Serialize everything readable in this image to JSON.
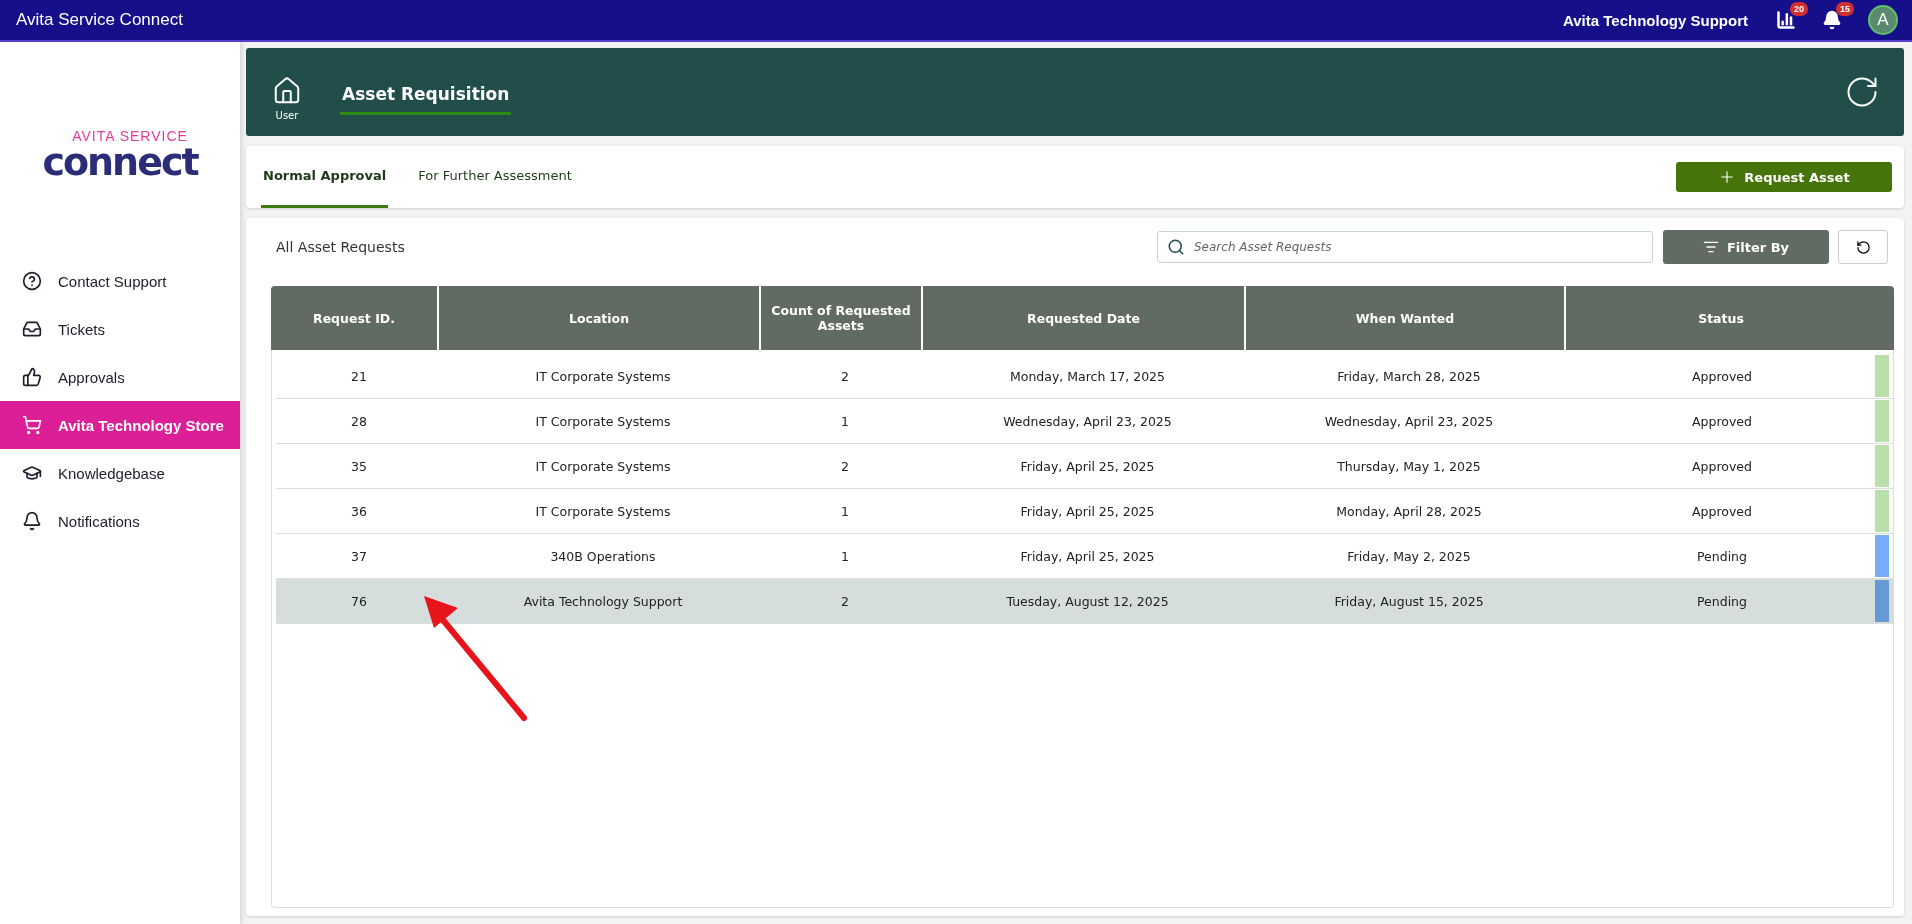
{
  "app_bar": {
    "title": "Avita Service Connect",
    "user_name": "Avita Technology Support",
    "report_badge": "20",
    "notification_badge": "15",
    "avatar_letter": "A"
  },
  "logo": {
    "top": "AVITA SERVICE",
    "bottom": "connect"
  },
  "sidebar": {
    "items": [
      {
        "label": "Contact Support",
        "selected": false
      },
      {
        "label": "Tickets",
        "selected": false
      },
      {
        "label": "Approvals",
        "selected": false
      },
      {
        "label": "Avita Technology Store",
        "selected": true
      },
      {
        "label": "Knowledgebase",
        "selected": false
      },
      {
        "label": "Notifications",
        "selected": false
      }
    ]
  },
  "header": {
    "home_label": "User",
    "title": "Asset Requisition"
  },
  "tabs": [
    {
      "label": "Normal Approval",
      "selected": true
    },
    {
      "label": "For Further Assessment",
      "selected": false
    }
  ],
  "request_button": "Request Asset",
  "list": {
    "title": "All Asset Requests",
    "search": {
      "placeholder": "Search Asset Requests"
    },
    "filter_button": "Filter By"
  },
  "table": {
    "columns": [
      "Request ID.",
      "Location",
      "Count of Requested Assets",
      "Requested Date",
      "When Wanted",
      "Status"
    ],
    "rows": [
      {
        "cells": [
          "21",
          "IT Corporate Systems",
          "2",
          "Monday, March 17, 2025",
          "Friday, March 28, 2025",
          "Approved"
        ],
        "color": "#b9dfaa",
        "selected": false
      },
      {
        "cells": [
          "28",
          "IT Corporate Systems",
          "1",
          "Wednesday, April 23, 2025",
          "Wednesday, April 23, 2025",
          "Approved"
        ],
        "color": "#b9dfaa",
        "selected": false
      },
      {
        "cells": [
          "35",
          "IT Corporate Systems",
          "2",
          "Friday, April 25, 2025",
          "Thursday, May 1, 2025",
          "Approved"
        ],
        "color": "#b9dfaa",
        "selected": false
      },
      {
        "cells": [
          "36",
          "IT Corporate Systems",
          "1",
          "Friday, April 25, 2025",
          "Monday, April 28, 2025",
          "Approved"
        ],
        "color": "#b9dfaa",
        "selected": false
      },
      {
        "cells": [
          "37",
          "340B Operations",
          "1",
          "Friday, April 25, 2025",
          "Friday, May 2, 2025",
          "Pending"
        ],
        "color": "#77adfc",
        "selected": false
      },
      {
        "cells": [
          "76",
          "Avita Technology Support",
          "2",
          "Tuesday, August 12, 2025",
          "Friday, August 15, 2025",
          "Pending"
        ],
        "color": "#6699d6",
        "selected": true
      }
    ]
  }
}
